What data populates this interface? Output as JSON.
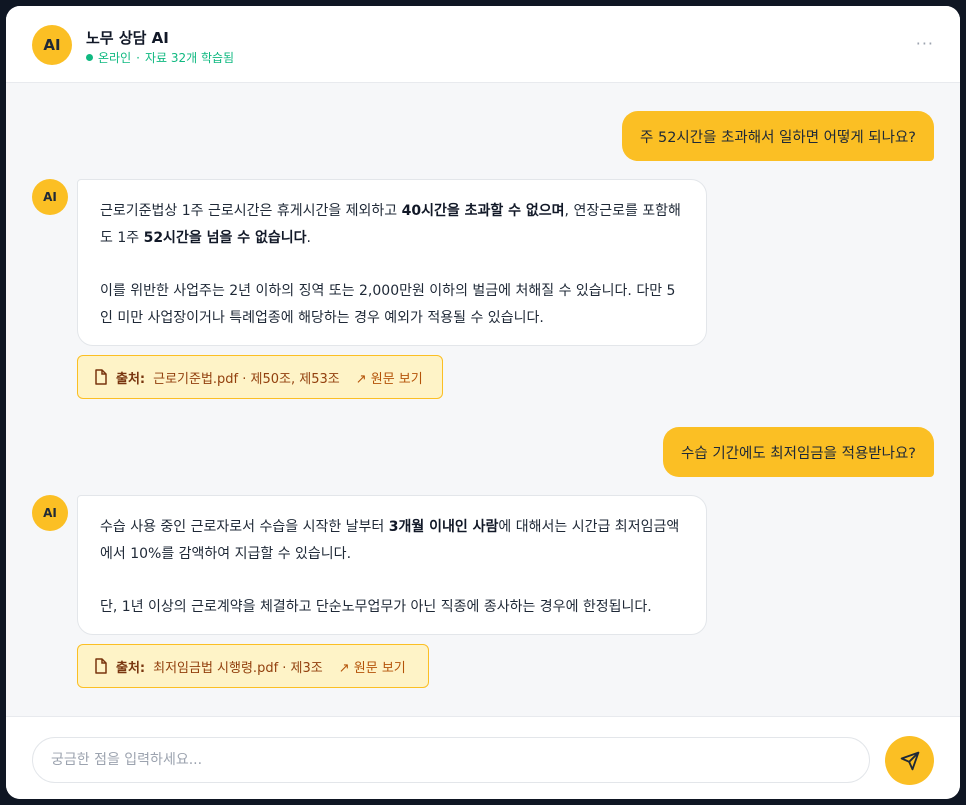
{
  "header": {
    "avatar": "AI",
    "title": "노무 상담 AI",
    "status_online": "온라인",
    "status_separator": "·",
    "status_detail": "자료 32개 학습됨",
    "menu_icon": "more-horizontal-icon",
    "menu": "···"
  },
  "messages": [
    {
      "user": "주 52시간을 초과해서 일하면 어떻게 되나요?",
      "ai_avatar": "AI",
      "ai_p1": [
        "근로기준법상 1주 근로시간은 휴게시간을 제외하고 ",
        "40시간을 초과할 수 없으며",
        ", 연장근로를 포함해도 1주 ",
        "52시간을 넘을 수 없습니다",
        "."
      ],
      "ai_p2": "이를 위반한 사업주는 2년 이하의 징역 또는 2,000만원 이하의 벌금에 처해질 수 있습니다. 다만 5인 미만 사업장이거나 특례업종에 해당하는 경우 예외가 적용될 수 있습니다.",
      "source_label": "출처:",
      "source_text": "근로기준법.pdf · 제50조, 제53조",
      "source_link": "↗ 원문 보기"
    },
    {
      "user": "수습 기간에도 최저임금을 적용받나요?",
      "ai_avatar": "AI",
      "ai_p1": [
        "수습 사용 중인 근로자로서 수습을 시작한 날부터 ",
        "3개월 이내인 사람",
        "에 대해서는 시간급 최저임금액에서 10%를 감액하여 지급할 수 있습니다."
      ],
      "ai_p2": "단, 1년 이상의 근로계약을 체결하고 단순노무업무가 아닌 직종에 종사하는 경우에 한정됩니다.",
      "source_label": "출처:",
      "source_text": "최저임금법 시행령.pdf · 제3조",
      "source_link": "↗ 원문 보기"
    }
  ],
  "composer": {
    "placeholder": "궁금한 점을 입력하세요...",
    "value": "",
    "send_icon": "send-icon"
  },
  "colors": {
    "accent": "#fbbf24",
    "online": "#10b981",
    "source_bg": "#fef3c7",
    "source_text": "#92400e"
  }
}
